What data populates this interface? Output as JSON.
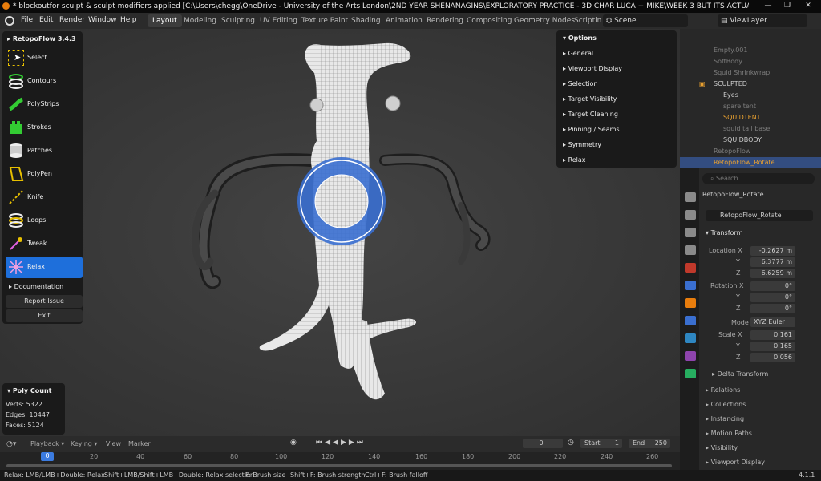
{
  "titlebar": {
    "title": "* blockoutfor sculpt & sculpt modifiers applied [C:\\Users\\chegg\\OneDrive - University of the Arts London\\2ND YEAR SHENANAGINS\\EXPLORATORY PRACTICE - 3D CHAR LUCA + MIKE\\WEEK 3 BUT ITS ACTUALLY EASTER HOLIDAYS IM LAZY\\block..."
  },
  "menubar": {
    "menus": [
      "File",
      "Edit",
      "Render",
      "Window",
      "Help"
    ],
    "workspaces": [
      "Layout",
      "Modeling",
      "Sculpting",
      "UV Editing",
      "Texture Paint",
      "Shading",
      "Animation",
      "Rendering",
      "Compositing",
      "Geometry Nodes",
      "Scriptin"
    ],
    "active_workspace": "Layout",
    "scene": "Scene",
    "viewlayer": "ViewLayer"
  },
  "retopo": {
    "title": "RetopoFlow 3.4.3",
    "tools": [
      "Select",
      "Contours",
      "PolyStrips",
      "Strokes",
      "Patches",
      "PolyPen",
      "Knife",
      "Loops",
      "Tweak",
      "Relax"
    ],
    "active_tool": "Relax",
    "documentation": "Documentation",
    "report": "Report Issue",
    "exit": "Exit"
  },
  "options": {
    "title": "Options",
    "items": [
      "General",
      "Viewport Display",
      "Selection",
      "Target Visibility",
      "Target Cleaning",
      "Pinning / Seams",
      "Symmetry",
      "Relax"
    ]
  },
  "polycount": {
    "title": "Poly Count",
    "verts_label": "Verts:",
    "verts": "5322",
    "edges_label": "Edges:",
    "edges": "10447",
    "faces_label": "Faces:",
    "faces": "5124"
  },
  "timeline": {
    "menus": [
      "Playback",
      "Keying",
      "View",
      "Marker"
    ],
    "current": "0",
    "start_label": "Start",
    "start": "1",
    "end_label": "End",
    "end": "250",
    "ticks": [
      "0",
      "20",
      "40",
      "60",
      "80",
      "100",
      "120",
      "140",
      "160",
      "180",
      "200",
      "220",
      "240",
      "260"
    ]
  },
  "statusbar": {
    "items": [
      "Relax: LMB/LMB+Double: Relax",
      "Shift+LMB/Shift+LMB+Double: Relax selection",
      "F: Brush size",
      "Shift+F: Brush strength",
      "Ctrl+F: Brush falloff"
    ],
    "version": "4.1.1"
  },
  "outliner": {
    "rows": [
      "Empty.001",
      "SoftBody",
      "Squid Shrinkwrap",
      "SCULPTED",
      "Eyes",
      "spare tent",
      "SQUIDTENT",
      "squid tail base",
      "SQUIDBODY",
      "RetopoFlow",
      "RetopoFlow_Rotate"
    ],
    "search_placeholder": "Search"
  },
  "props": {
    "object_name": "RetopoFlow_Rotate",
    "data_name": "RetopoFlow_Rotate",
    "transform": "Transform",
    "location_label": "Location X",
    "loc_x": "-0.2627 m",
    "loc_y": "6.3777 m",
    "loc_z": "6.6259 m",
    "rotation_label": "Rotation X",
    "rot_x": "0°",
    "rot_y": "0°",
    "rot_z": "0°",
    "mode_label": "Mode",
    "mode": "XYZ Euler",
    "scale_label": "Scale X",
    "scale_x": "0.161",
    "scale_y": "0.165",
    "scale_z": "0.056",
    "y_label": "Y",
    "z_label": "Z",
    "sections": [
      "Delta Transform",
      "Relations",
      "Collections",
      "Instancing",
      "Motion Paths",
      "Visibility",
      "Viewport Display"
    ]
  },
  "colors": {
    "accent": "#1e6fdb",
    "brand": "#e87d0d",
    "bg": "#3d3d3d"
  }
}
